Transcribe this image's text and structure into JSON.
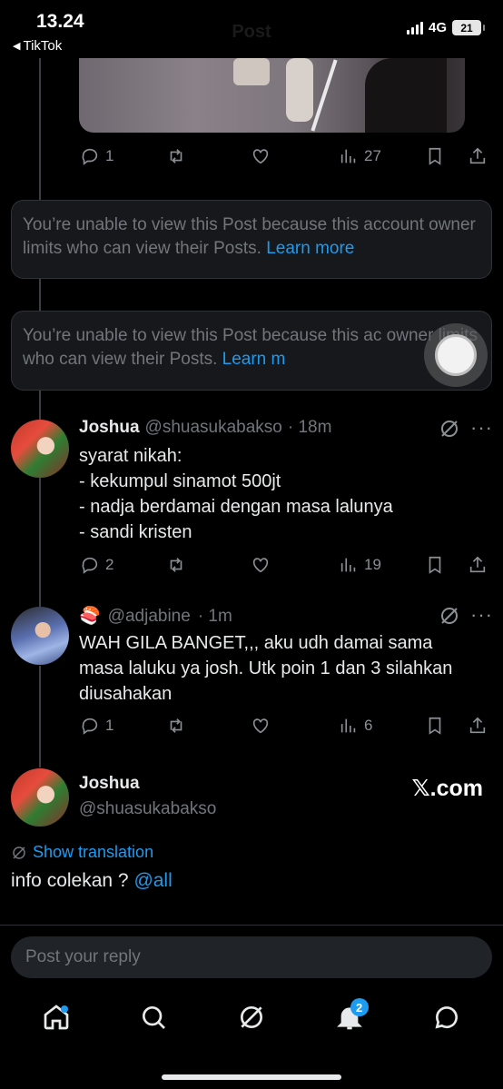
{
  "status_bar": {
    "time": "13.24",
    "back_app": "TikTok",
    "network": "4G",
    "battery": "21"
  },
  "header": {
    "title": "Post"
  },
  "post_top": {
    "actions": {
      "replies": "1",
      "views": "27"
    }
  },
  "notices": [
    {
      "text": "You’re unable to view this Post because this account owner limits who can view their Posts.",
      "link": "Learn more"
    },
    {
      "text": "You’re unable to view this Post because this ac owner limits who can view their Posts.",
      "link": "Learn m"
    }
  ],
  "reply1": {
    "name": "Joshua",
    "handle": "@shuasukabakso",
    "time": "· 18m",
    "lines": [
      "syarat nikah:",
      "- kekumpul sinamot 500jt",
      "- nadja berdamai dengan masa lalunya",
      "- sandi kristen"
    ],
    "replies": "2",
    "views": "19"
  },
  "reply2": {
    "emoji": "🍣",
    "handle": "@adjabine",
    "time": "· 1m",
    "lines": [
      "WAH GILA BANGET,,, aku udh damai sama",
      "masa laluku ya josh. Utk poin 1 dan 3 silahkan",
      "diusahakan"
    ],
    "replies": "1",
    "views": "6"
  },
  "main_post": {
    "name": "Joshua",
    "handle": "@shuasukabakso",
    "watermark": "𝕏.com",
    "show_translation": "Show translation",
    "text": "info colekan ?",
    "mention": "@all"
  },
  "composer": {
    "placeholder": "Post your reply"
  },
  "tabbar": {
    "notifications_badge": "2"
  }
}
